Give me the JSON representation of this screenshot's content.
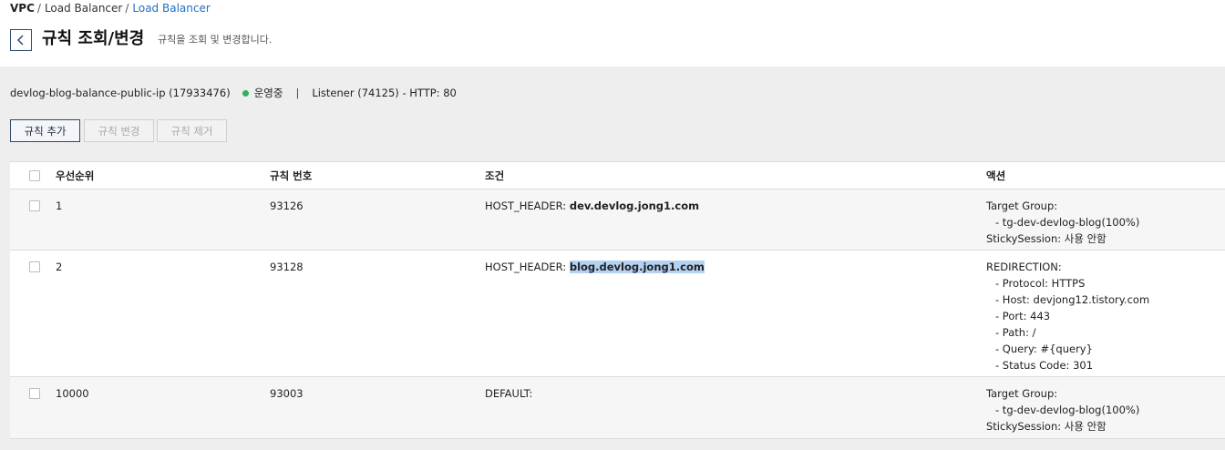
{
  "breadcrumb": {
    "root": "VPC",
    "separator": "/",
    "items": [
      "Load Balancer",
      "Load Balancer"
    ]
  },
  "header": {
    "title": "규칙 조회/변경",
    "subtitle": "규칙을 조회 및 변경합니다."
  },
  "info": {
    "load_balancer": "devlog-blog-balance-public-ip (17933476)",
    "status": "운영중",
    "status_color": "#2fb35a",
    "separator": "|",
    "listener": "Listener (74125) - HTTP: 80"
  },
  "toolbar": {
    "add_label": "규칙 추가",
    "change_label": "규칙 변경",
    "remove_label": "규칙 제거"
  },
  "table": {
    "columns": [
      "우선순위",
      "규칙 번호",
      "조건",
      "액션"
    ],
    "rows": [
      {
        "priority": "1",
        "rule_no": "93126",
        "condition_prefix": "HOST_HEADER: ",
        "condition_value": "dev.devlog.jong1.com",
        "actions": [
          "Target Group:",
          "- tg-dev-devlog-blog(100%)",
          "StickySession: 사용 안함"
        ]
      },
      {
        "priority": "2",
        "rule_no": "93128",
        "condition_prefix": "HOST_HEADER: ",
        "condition_value": "blog.devlog.jong1.com",
        "actions": [
          "REDIRECTION:",
          "- Protocol: HTTPS",
          "- Host: devjong12.tistory.com",
          "- Port: 443",
          "- Path: /",
          "- Query: #{query}",
          "- Status Code: 301"
        ]
      },
      {
        "priority": "10000",
        "rule_no": "93003",
        "condition_prefix": "DEFAULT:",
        "condition_value": "",
        "actions": [
          "Target Group:",
          "- tg-dev-devlog-blog(100%)",
          "StickySession: 사용 안함"
        ]
      }
    ]
  },
  "colors": {
    "accent": "#1f6fc7",
    "content_bg": "#eeeeee",
    "selection_highlight": "#b3d1f2"
  }
}
